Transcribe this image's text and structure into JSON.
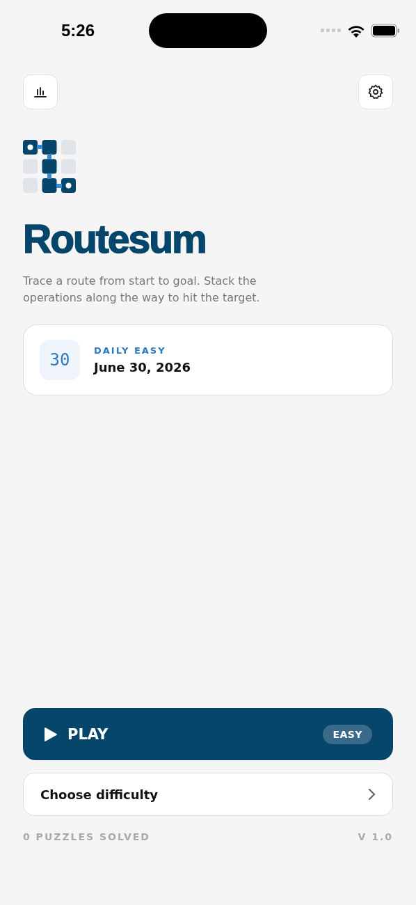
{
  "status_bar": {
    "time": "5:26"
  },
  "app": {
    "title": "Routesum",
    "description": "Trace a route from start to goal. Stack the operations along the way to hit the target."
  },
  "daily_card": {
    "day": "30",
    "label": "DAILY EASY",
    "date": "June 30, 2026"
  },
  "play_button": {
    "label": "PLAY",
    "badge": "EASY"
  },
  "difficulty_button": {
    "label": "Choose difficulty"
  },
  "footer": {
    "solved": "0 PUZZLES SOLVED",
    "version": "V 1.0"
  }
}
